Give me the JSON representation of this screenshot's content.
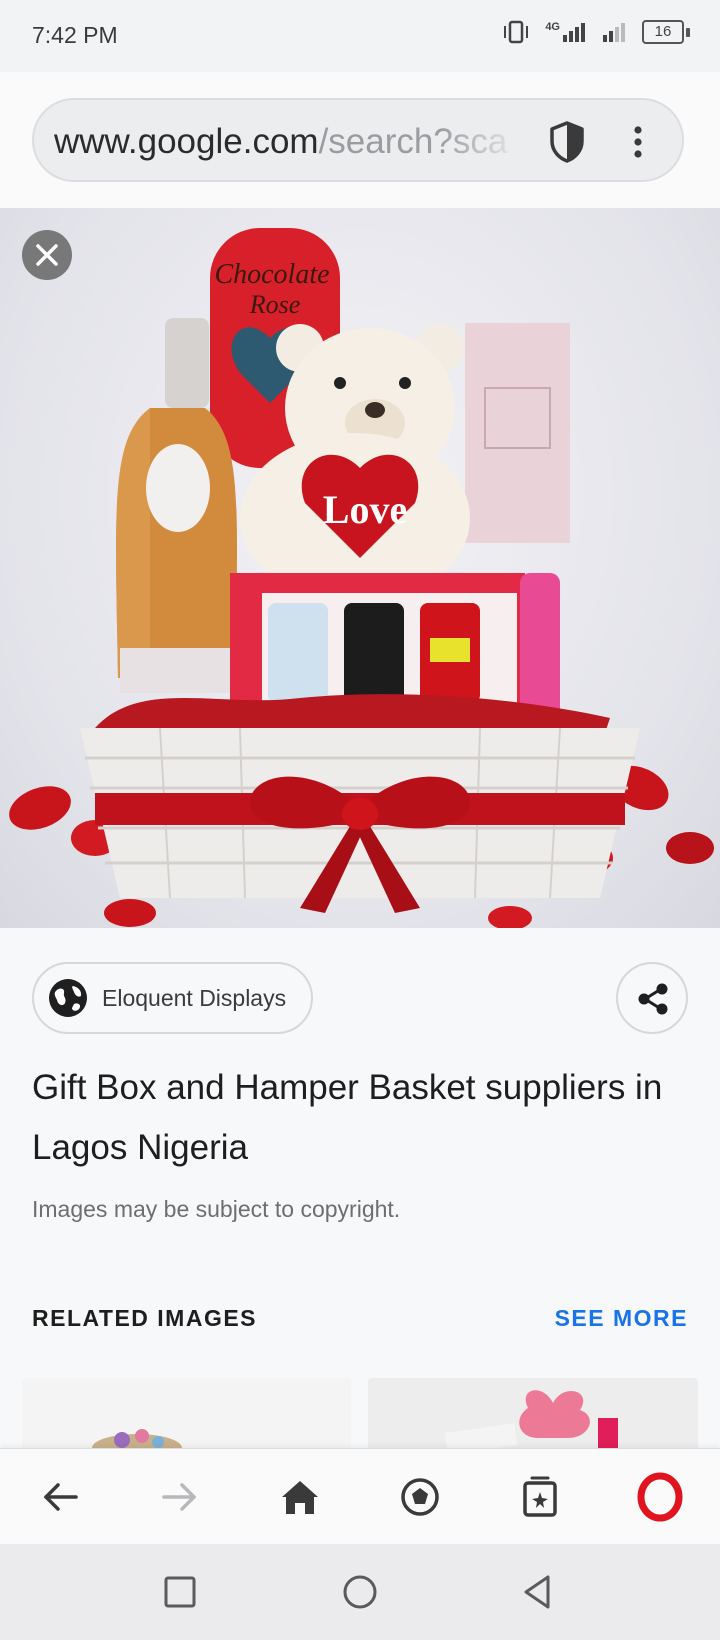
{
  "status_bar": {
    "time": "7:42 PM",
    "network": "4G",
    "battery": "16",
    "icons": [
      "vibrate-icon",
      "signal-4g-icon",
      "signal-icon",
      "battery-icon"
    ]
  },
  "url_bar": {
    "host": "www.google.com",
    "path": "/search?sca",
    "icons": [
      "shield-icon",
      "more-vert-icon"
    ]
  },
  "image_viewer": {
    "close_icon": "close-icon",
    "image_description_hidden": "",
    "source": {
      "label": "Eloquent Displays",
      "icon": "globe-icon"
    },
    "share_icon": "share-icon",
    "title": "Gift Box and Hamper Basket suppliers in Lagos Nigeria",
    "copyright": "Images may be subject to copyright."
  },
  "related": {
    "header": "RELATED IMAGES",
    "see_more": "SEE MORE"
  },
  "bottom_nav": {
    "items": [
      "back-icon",
      "forward-icon",
      "home-icon",
      "speed-dial-icon",
      "tabs-icon",
      "opera-menu-icon"
    ]
  },
  "system_nav": {
    "items": [
      "recents-icon",
      "home-circle-icon",
      "back-triangle-icon"
    ]
  },
  "colors": {
    "accent": "#1a73e8",
    "opera_red": "#e0141e",
    "background": "#f7f8fa"
  }
}
